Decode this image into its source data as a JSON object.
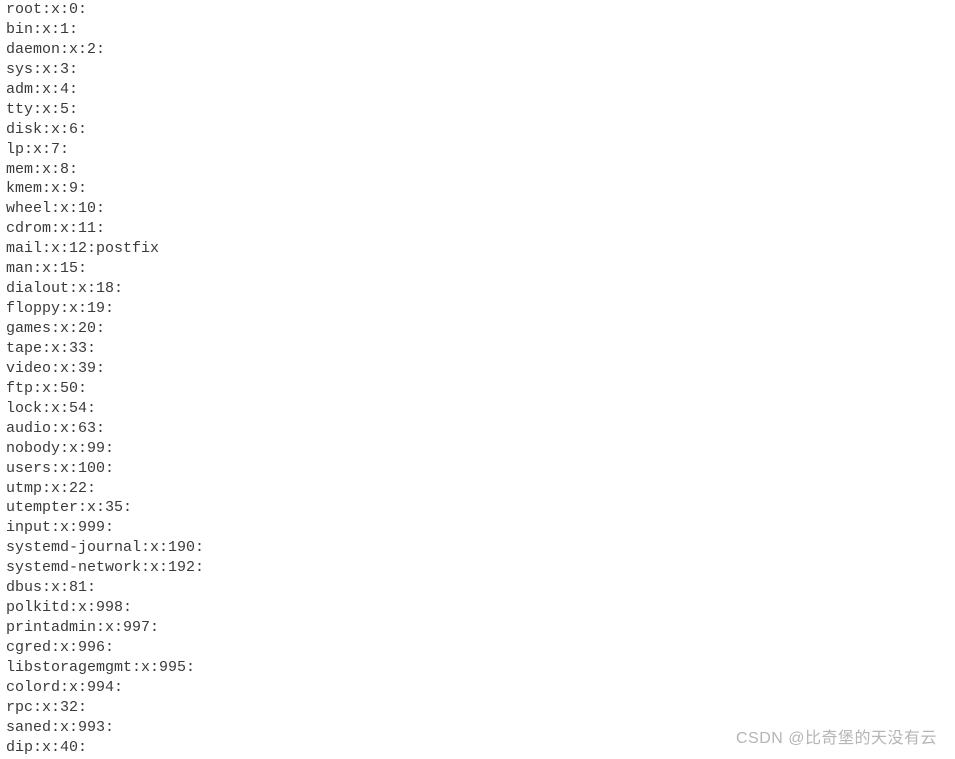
{
  "group_file": {
    "lines": [
      "root:x:0:",
      "bin:x:1:",
      "daemon:x:2:",
      "sys:x:3:",
      "adm:x:4:",
      "tty:x:5:",
      "disk:x:6:",
      "lp:x:7:",
      "mem:x:8:",
      "kmem:x:9:",
      "wheel:x:10:",
      "cdrom:x:11:",
      "mail:x:12:postfix",
      "man:x:15:",
      "dialout:x:18:",
      "floppy:x:19:",
      "games:x:20:",
      "tape:x:33:",
      "video:x:39:",
      "ftp:x:50:",
      "lock:x:54:",
      "audio:x:63:",
      "nobody:x:99:",
      "users:x:100:",
      "utmp:x:22:",
      "utempter:x:35:",
      "input:x:999:",
      "systemd-journal:x:190:",
      "systemd-network:x:192:",
      "dbus:x:81:",
      "polkitd:x:998:",
      "printadmin:x:997:",
      "cgred:x:996:",
      "libstoragemgmt:x:995:",
      "colord:x:994:",
      "rpc:x:32:",
      "saned:x:993:",
      "dip:x:40:"
    ]
  },
  "watermark": "CSDN @比奇堡的天没有云"
}
